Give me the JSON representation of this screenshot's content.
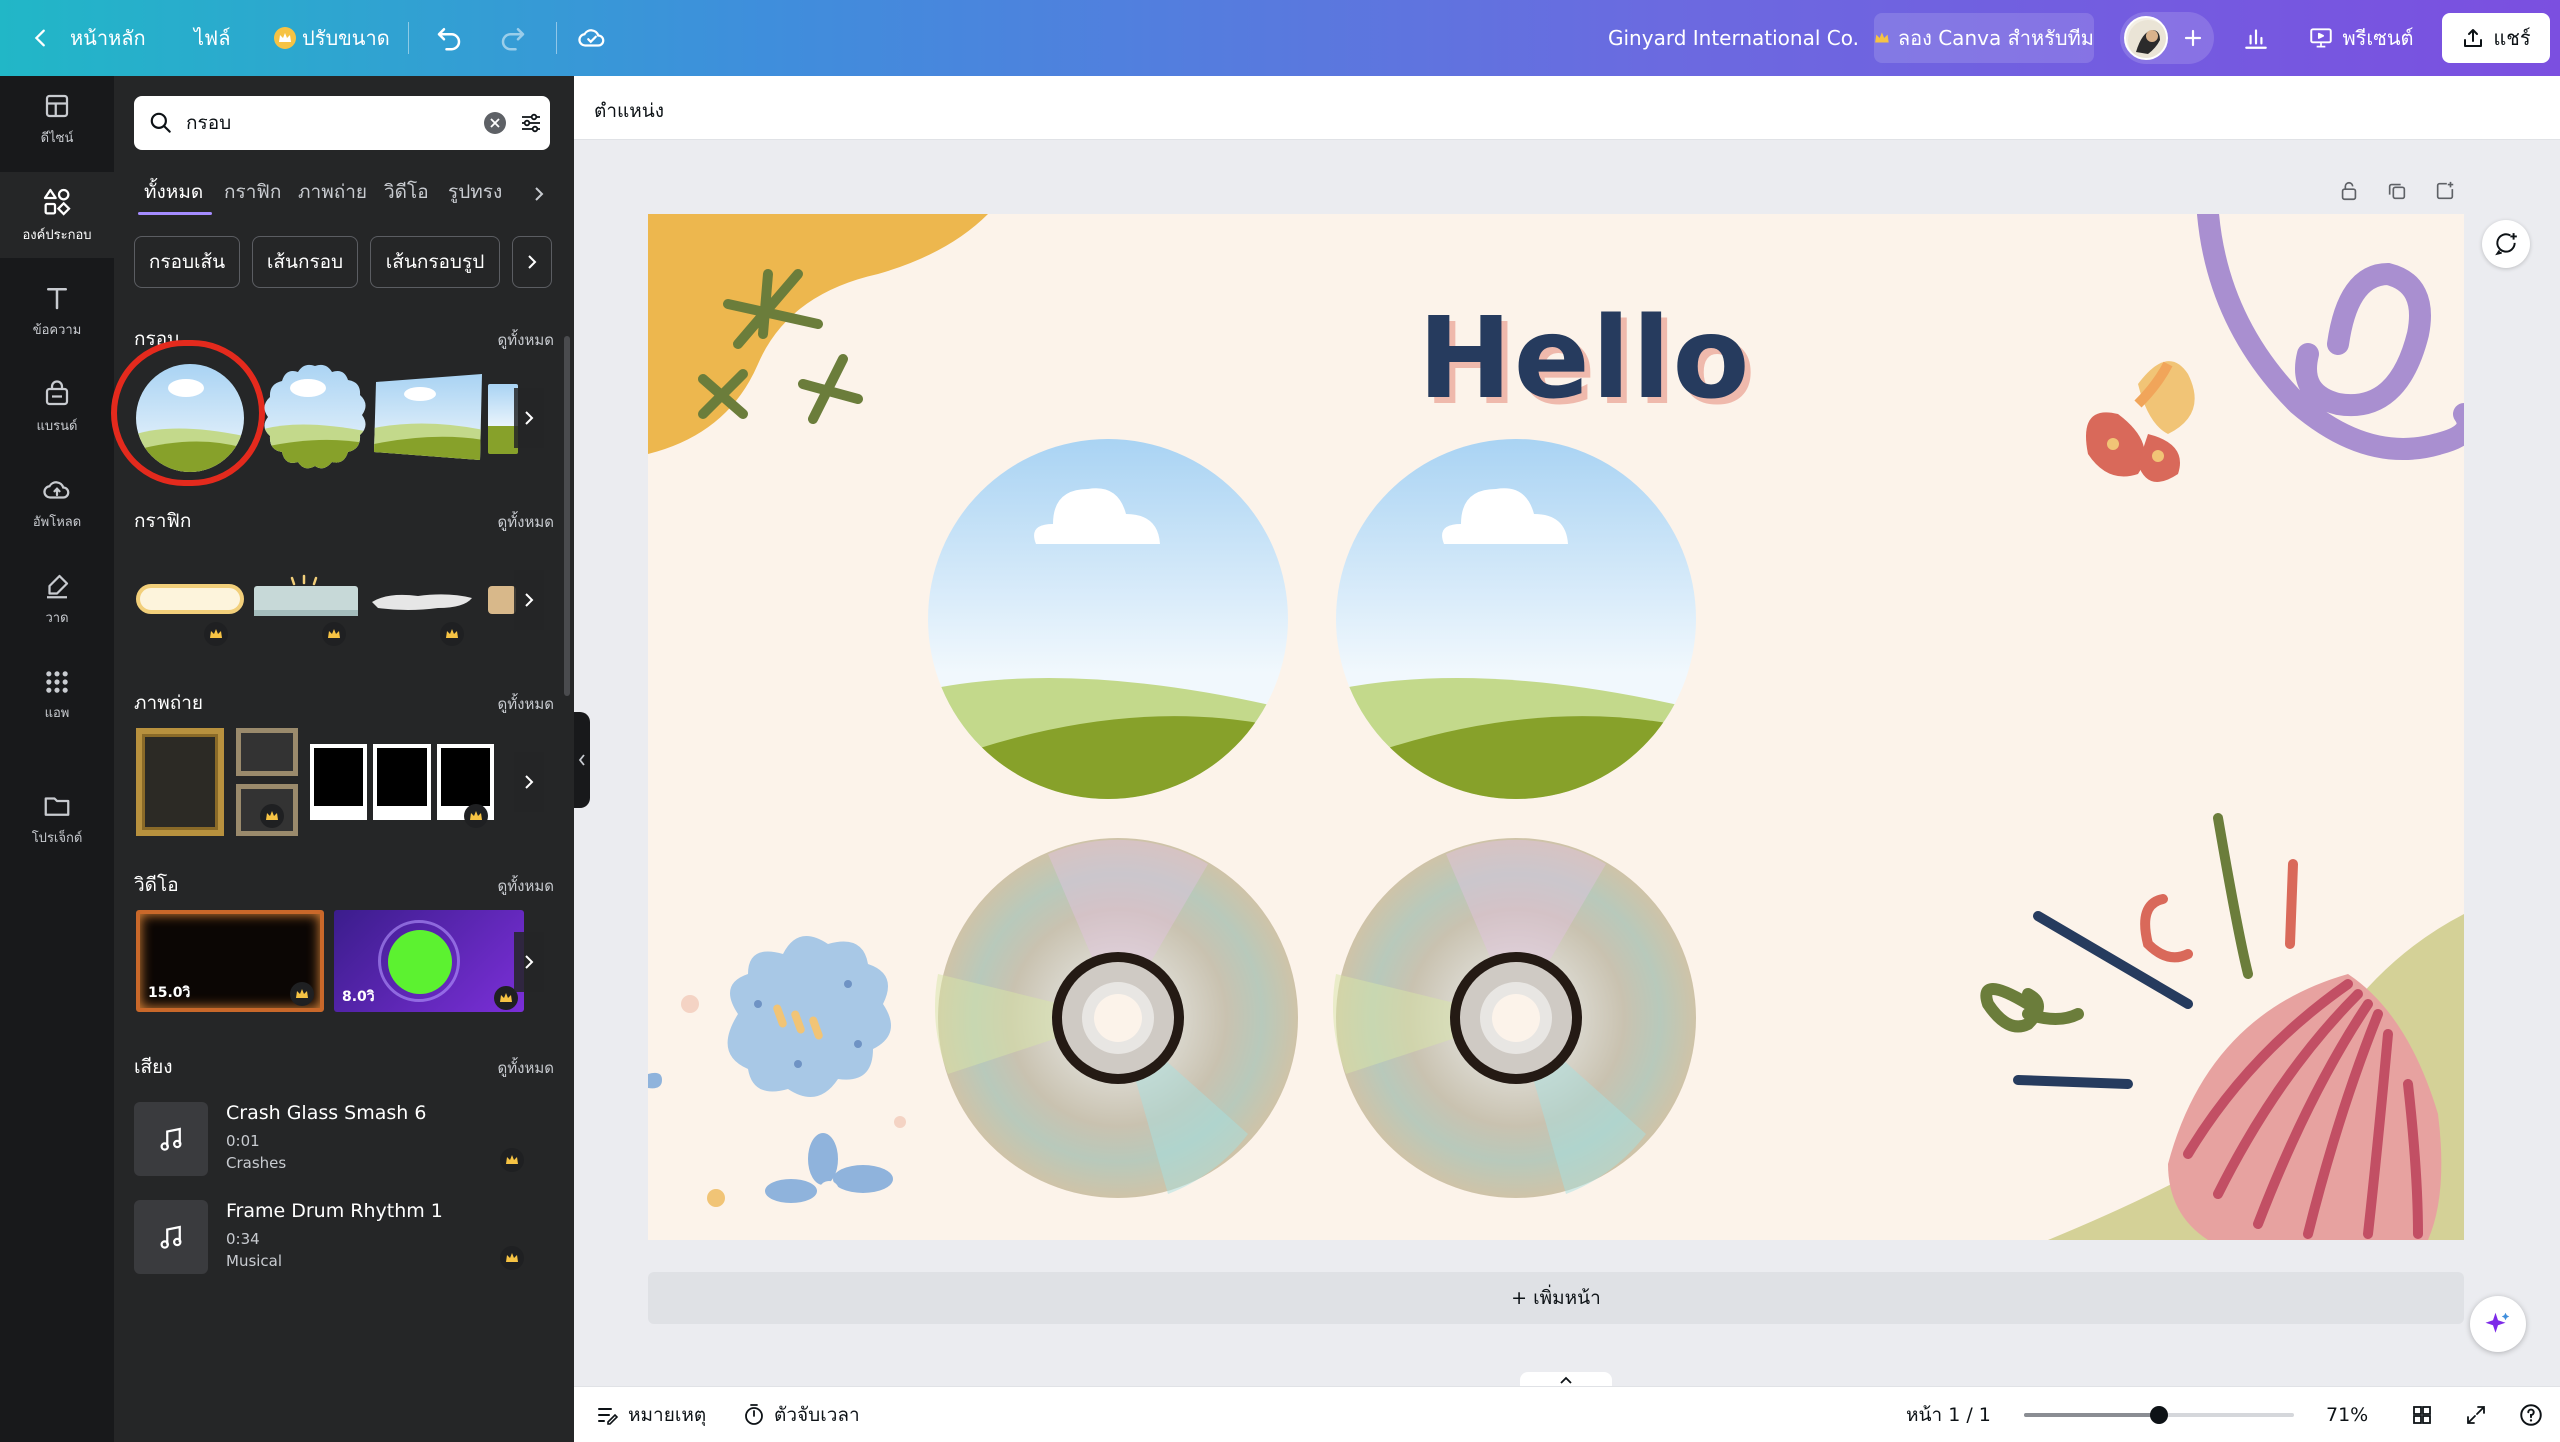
{
  "topbar": {
    "home_label": "หน้าหลัก",
    "file_label": "ไฟล์",
    "resize_label": "ปรับขนาด",
    "team_name": "Ginyard International Co.",
    "try_team_label": "ลอง Canva สำหรับทีม",
    "present_label": "พรีเซนต์",
    "share_label": "แชร์"
  },
  "rail": {
    "items": [
      {
        "label": "ดีไซน์",
        "icon": "layout-icon"
      },
      {
        "label": "องค์ประกอบ",
        "icon": "shapes-icon"
      },
      {
        "label": "ข้อความ",
        "icon": "text-icon"
      },
      {
        "label": "แบรนด์",
        "icon": "brand-icon"
      },
      {
        "label": "อัพโหลด",
        "icon": "upload-icon"
      },
      {
        "label": "วาด",
        "icon": "draw-icon"
      },
      {
        "label": "แอพ",
        "icon": "apps-icon"
      },
      {
        "label": "โปรเจ็กต์",
        "icon": "folder-icon"
      }
    ]
  },
  "panel": {
    "search_value": "กรอบ",
    "tabs": [
      "ทั้งหมด",
      "กราฟิก",
      "ภาพถ่าย",
      "วิดีโอ",
      "รูปทรง"
    ],
    "chips": [
      "กรอบเส้น",
      "เส้นกรอบ",
      "เส้นกรอบรูป"
    ],
    "see_all": "ดูทั้งหมด",
    "sections": {
      "frames": "กรอบ",
      "graphics": "กราฟิก",
      "photos": "ภาพถ่าย",
      "videos": "วิดีโอ",
      "audio": "เสียง"
    },
    "videos": [
      {
        "duration": "15.0วิ"
      },
      {
        "duration": "8.0วิ"
      }
    ],
    "audio": [
      {
        "title": "Crash Glass Smash 6",
        "duration": "0:01",
        "category": "Crashes"
      },
      {
        "title": "Frame Drum Rhythm 1",
        "duration": "0:34",
        "category": "Musical"
      }
    ]
  },
  "canvas": {
    "position_label": "ตำแหน่ง",
    "heading": "Hello",
    "add_page_label": "+ เพิ่มหน้า"
  },
  "bottombar": {
    "notes_label": "หมายเหตุ",
    "timer_label": "ตัวจับเวลา",
    "page_indicator": "หน้า 1 / 1",
    "zoom": "71%",
    "zoom_fraction": 0.5
  },
  "colors": {
    "accent_highlight": "#e42a1d",
    "canvas_bg": "#fcf3ea",
    "heading": "#263b5e"
  }
}
